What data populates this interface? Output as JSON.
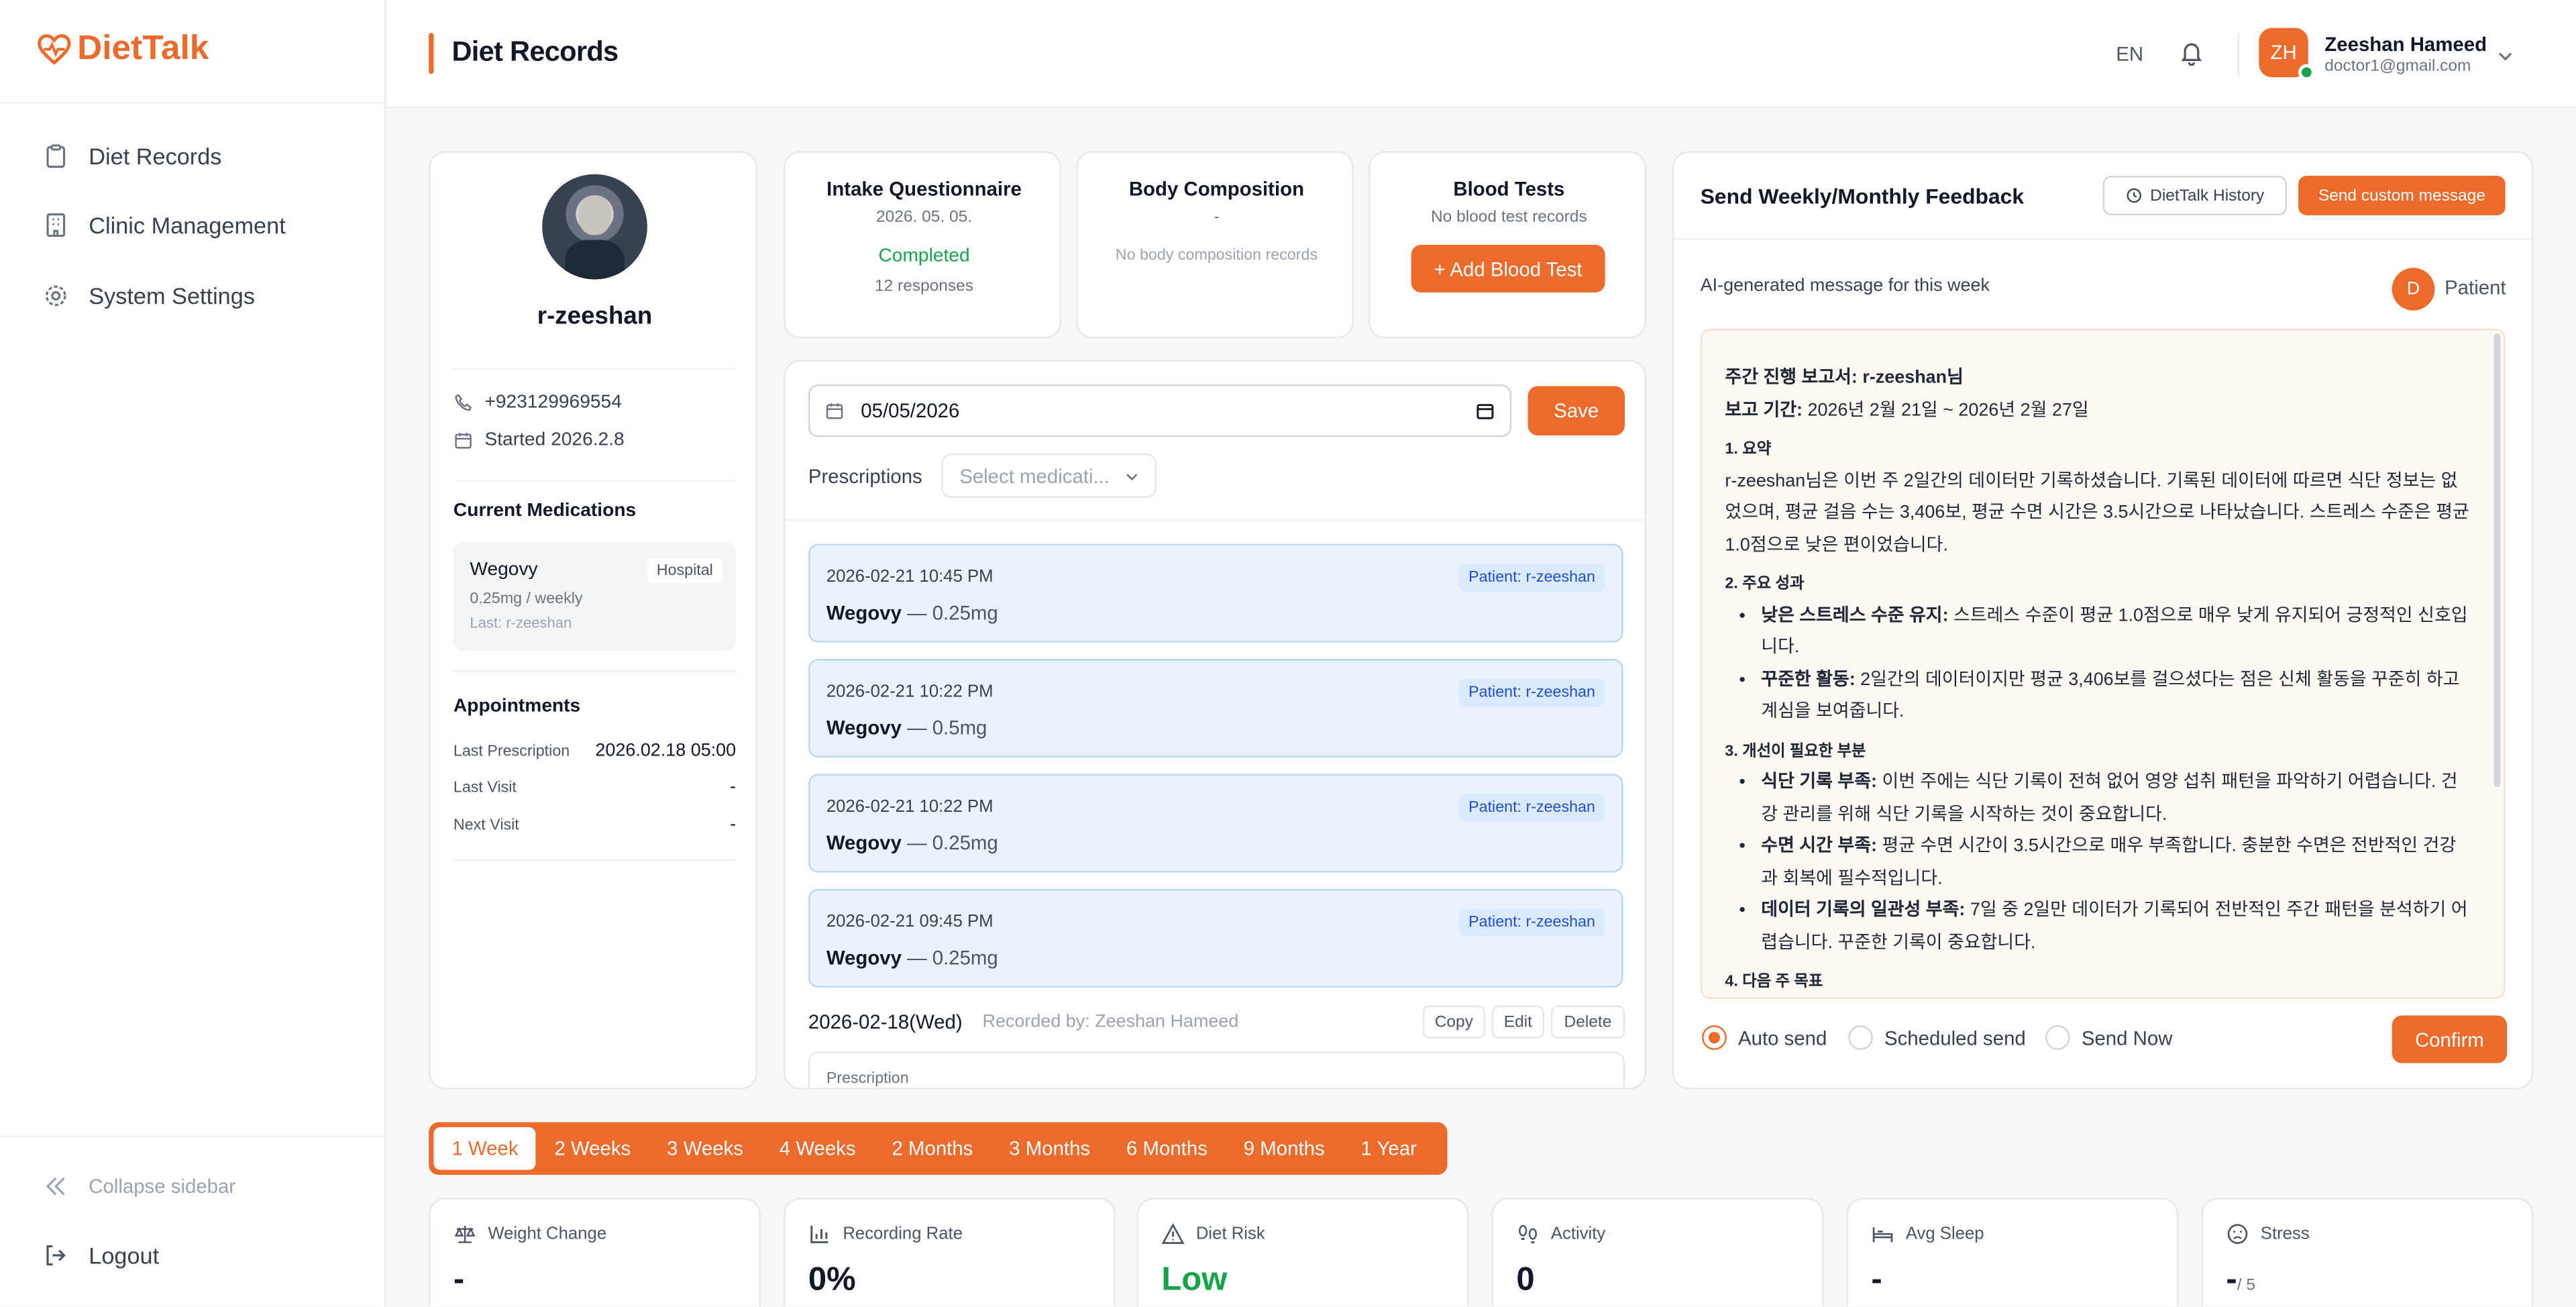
{
  "app": {
    "name": "DietTalk"
  },
  "sidebar": {
    "items": [
      {
        "label": "Diet Records",
        "icon": "clipboard-icon"
      },
      {
        "label": "Clinic Management",
        "icon": "building-icon"
      },
      {
        "label": "System Settings",
        "icon": "gear-icon"
      }
    ],
    "collapse_label": "Collapse sidebar",
    "logout_label": "Logout"
  },
  "header": {
    "title": "Diet Records",
    "lang": "EN",
    "user": {
      "initials": "ZH",
      "name": "Zeeshan Hameed",
      "email": "doctor1@gmail.com"
    }
  },
  "patient": {
    "name": "r-zeeshan",
    "phone": "+923129969554",
    "started": "Started 2026.2.8",
    "medications_title": "Current Medications",
    "medication": {
      "name": "Wegovy",
      "badge": "Hospital",
      "dose": "0.25mg / weekly",
      "last": "Last: r-zeeshan"
    },
    "appointments_title": "Appointments",
    "appointments": [
      {
        "label": "Last Prescription",
        "value": "2026.02.18 05:00"
      },
      {
        "label": "Last Visit",
        "value": "-"
      },
      {
        "label": "Next Visit",
        "value": "-"
      }
    ]
  },
  "intake": {
    "title": "Intake Questionnaire",
    "date": "2026. 05. 05.",
    "status": "Completed",
    "responses": "12 responses"
  },
  "body_comp": {
    "title": "Body Composition",
    "value": "-",
    "empty": "No body composition records"
  },
  "blood": {
    "title": "Blood Tests",
    "empty": "No blood test records",
    "button": "+ Add Blood Test"
  },
  "records": {
    "date_value": "05/05/2026",
    "save_label": "Save",
    "prescriptions_label": "Prescriptions",
    "select_placeholder": "Select medicati...",
    "items": [
      {
        "datetime": "2026-02-21 10:45 PM",
        "patient": "Patient: r-zeeshan",
        "med": "Wegovy",
        "dose": " — 0.25mg"
      },
      {
        "datetime": "2026-02-21 10:22 PM",
        "patient": "Patient: r-zeeshan",
        "med": "Wegovy",
        "dose": " — 0.5mg"
      },
      {
        "datetime": "2026-02-21 10:22 PM",
        "patient": "Patient: r-zeeshan",
        "med": "Wegovy",
        "dose": " — 0.25mg"
      },
      {
        "datetime": "2026-02-21 09:45 PM",
        "patient": "Patient: r-zeeshan",
        "med": "Wegovy",
        "dose": " — 0.25mg"
      }
    ],
    "day_label": "2026-02-18(Wed)",
    "recorded_by": "Recorded by: Zeeshan Hameed",
    "copy": "Copy",
    "edit": "Edit",
    "delete": "Delete",
    "subsection": "Prescription"
  },
  "feedback": {
    "title": "Send Weekly/Monthly Feedback",
    "history_btn": "DietTalk History",
    "custom_btn": "Send custom message",
    "ai_label": "AI-generated message for this week",
    "recipient_initial": "D",
    "recipient": "Patient",
    "report": {
      "title": "주간 진행 보고서: r-zeeshan님",
      "period_label": "보고 기간:",
      "period": " 2026년 2월 21일 ~ 2026년 2월 27일",
      "s1": "1. 요약",
      "s1_text": "r-zeeshan님은 이번 주 2일간의 데이터만 기록하셨습니다. 기록된 데이터에 따르면 식단 정보는 없었으며, 평균 걸음 수는 3,406보, 평균 수면 시간은 3.5시간으로 나타났습니다. 스트레스 수준은 평균 1.0점으로 낮은 편이었습니다.",
      "s2": "2. 주요 성과",
      "s2_b1": "낮은 스트레스 수준 유지:",
      "s2_t1": " 스트레스 수준이 평균 1.0점으로 매우 낮게 유지되어 긍정적인 신호입니다.",
      "s2_b2": "꾸준한 활동:",
      "s2_t2": " 2일간의 데이터이지만 평균 3,406보를 걸으셨다는 점은 신체 활동을 꾸준히 하고 계심을 보여줍니다.",
      "s3": "3. 개선이 필요한 부분",
      "s3_b1": "식단 기록 부족:",
      "s3_t1": " 이번 주에는 식단 기록이 전혀 없어 영양 섭취 패턴을 파악하기 어렵습니다. 건강 관리를 위해 식단 기록을 시작하는 것이 중요합니다.",
      "s3_b2": "수면 시간 부족:",
      "s3_t2": " 평균 수면 시간이 3.5시간으로 매우 부족합니다. 충분한 수면은 전반적인 건강과 회복에 필수적입니다.",
      "s3_b3": "데이터 기록의 일관성 부족:",
      "s3_t3": " 7일 중 2일만 데이터가 기록되어 전반적인 주간 패턴을 분석하기 어렵습니다. 꾸준한 기록이 중요합니다.",
      "s4": "4. 다음 주 목표"
    },
    "options": [
      "Auto send",
      "Scheduled send",
      "Send Now"
    ],
    "confirm": "Confirm"
  },
  "periods": [
    "1 Week",
    "2 Weeks",
    "3 Weeks",
    "4 Weeks",
    "2 Months",
    "3 Months",
    "6 Months",
    "9 Months",
    "1 Year"
  ],
  "stats": [
    {
      "label": "Weight Change",
      "value": "-",
      "icon": "scale-icon"
    },
    {
      "label": "Recording Rate",
      "value": "0%",
      "icon": "bar-chart-icon"
    },
    {
      "label": "Diet Risk",
      "value": "Low",
      "icon": "warning-icon",
      "color": "#16a34a"
    },
    {
      "label": "Activity",
      "value": "0",
      "icon": "footprints-icon"
    },
    {
      "label": "Avg Sleep",
      "value": "-",
      "icon": "bed-icon"
    },
    {
      "label": "Stress",
      "value": "-",
      "suffix": " / 5",
      "icon": "frown-icon"
    }
  ],
  "colors": {
    "accent": "#ec6a2c",
    "success": "#16a34a",
    "info": "#1d4ed8"
  }
}
